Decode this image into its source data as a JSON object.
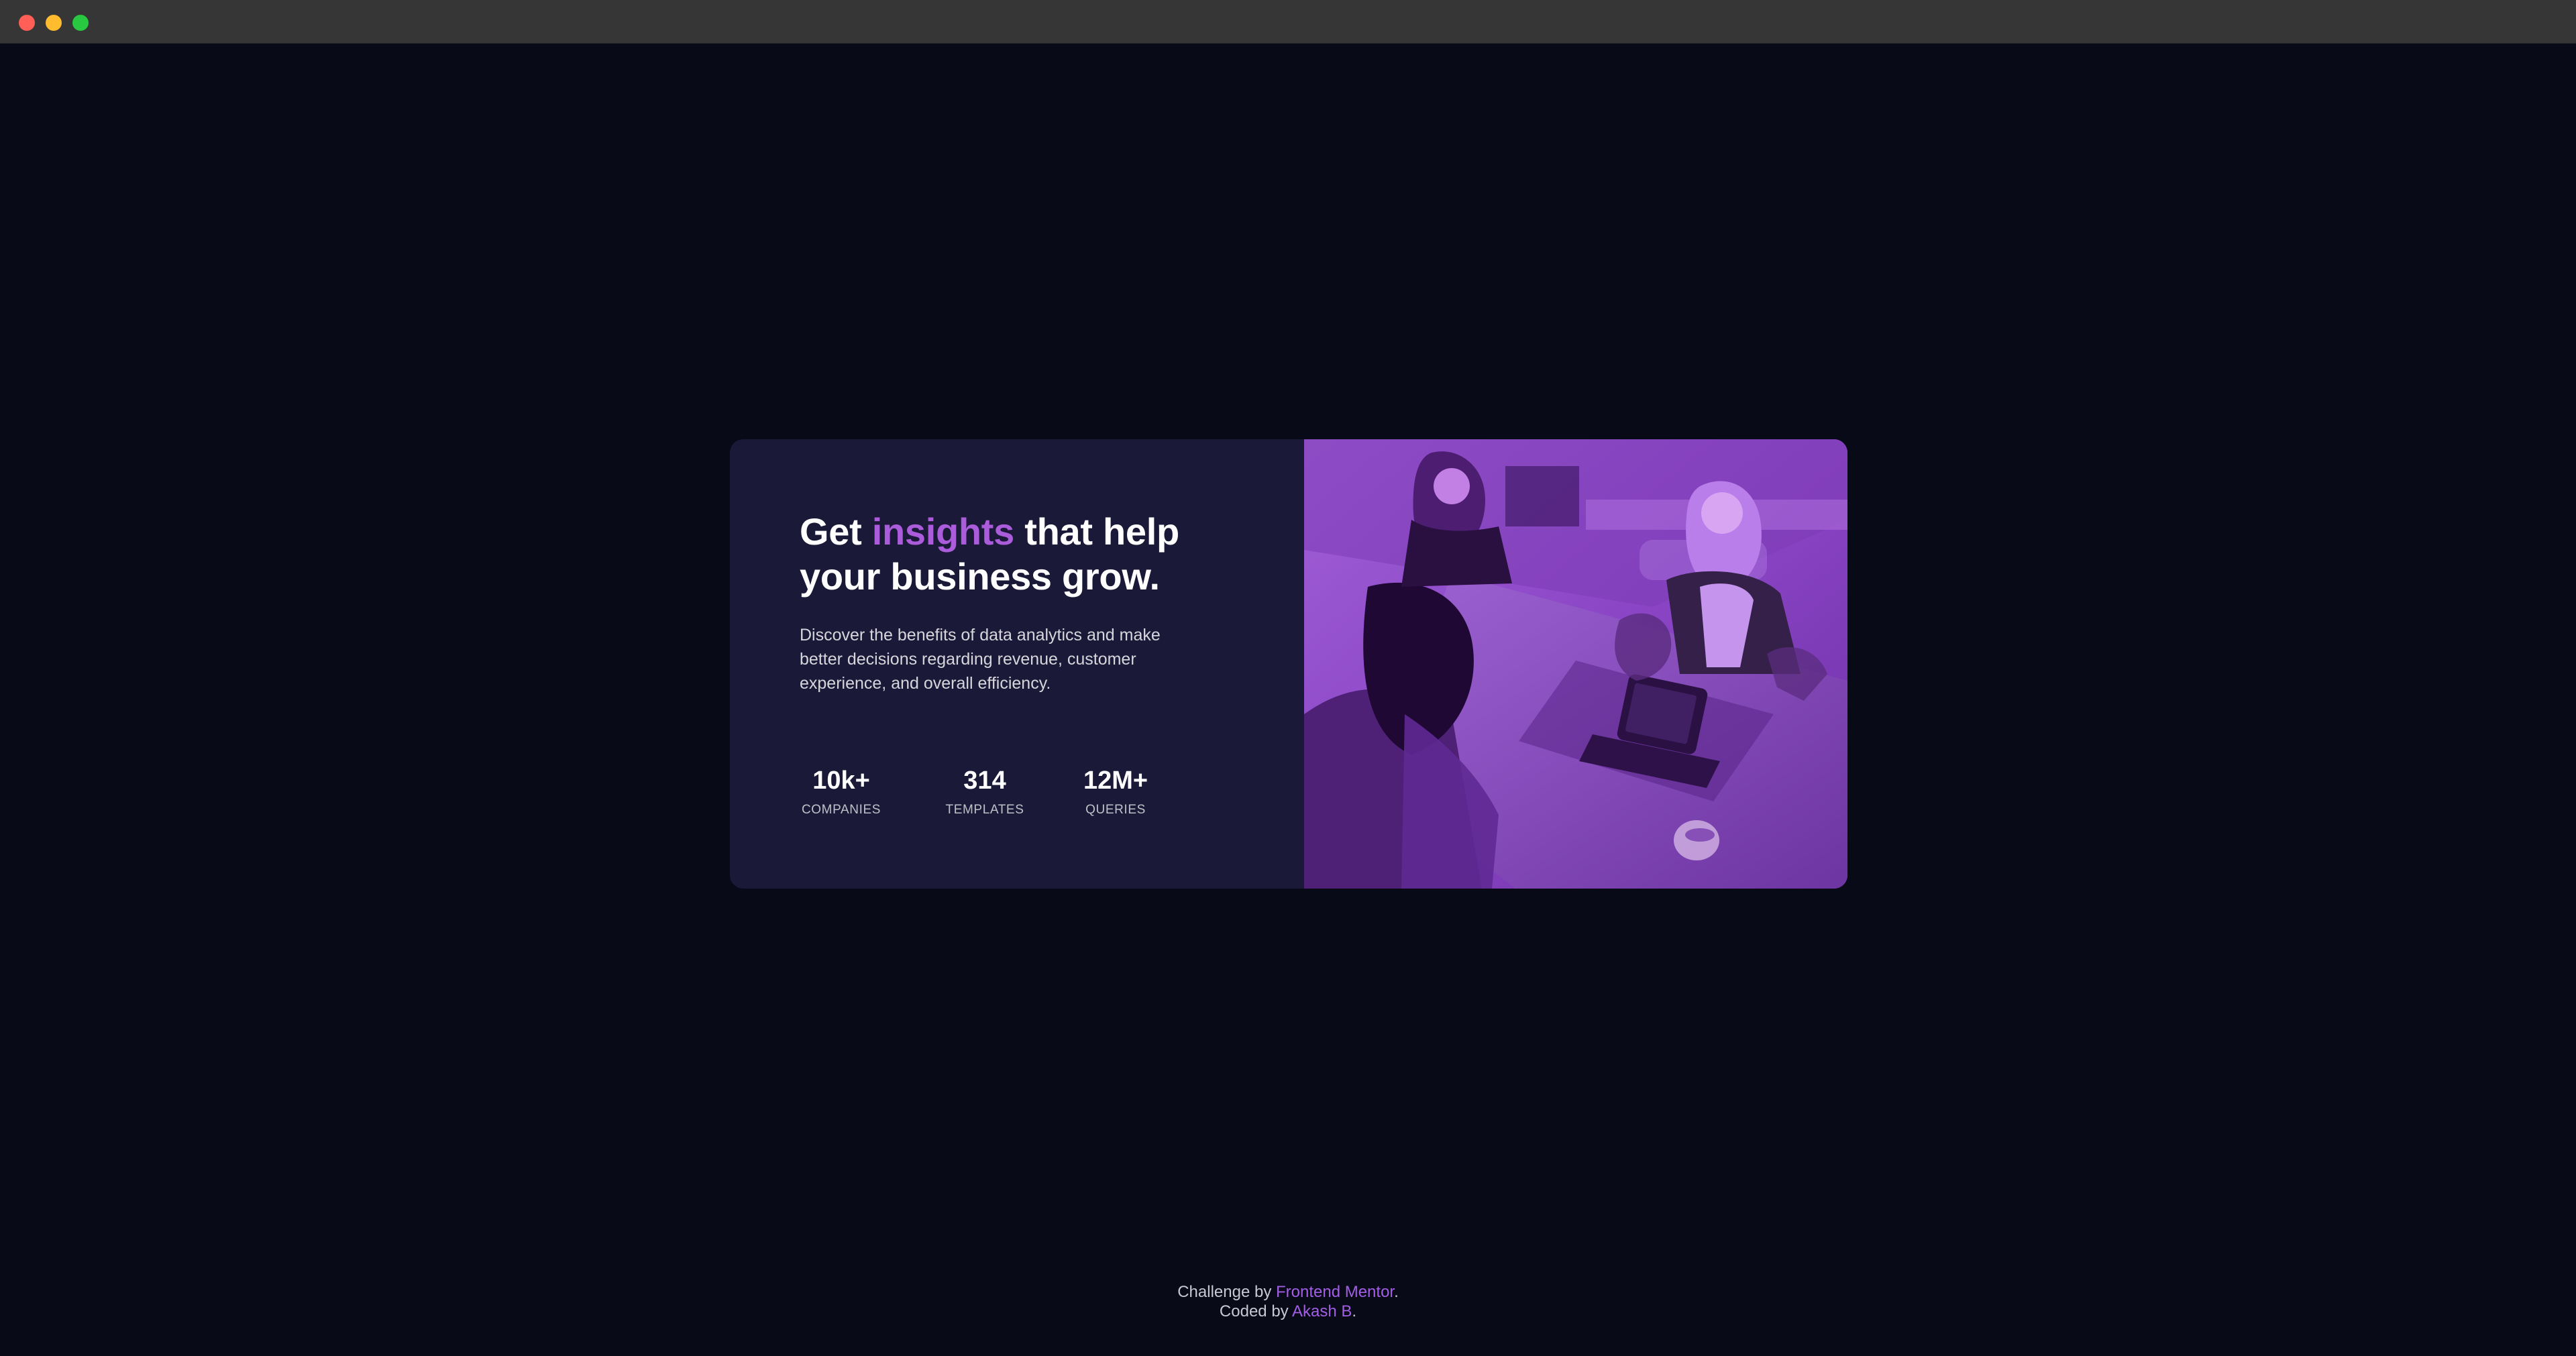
{
  "window": {
    "controls": [
      "close",
      "minimize",
      "maximize"
    ]
  },
  "card": {
    "headline_prefix": "Get ",
    "headline_accent": "insights",
    "headline_suffix": " that help your business grow.",
    "description": "Discover the benefits of data analytics and make better decisions regarding revenue, customer experience, and overall efficiency.",
    "stats": [
      {
        "value": "10k+",
        "label": "COMPANIES"
      },
      {
        "value": "314",
        "label": "TEMPLATES"
      },
      {
        "value": "12M+",
        "label": "QUERIES"
      }
    ],
    "image_icon": "office-meeting-photo"
  },
  "footer": {
    "challenge_prefix": "Challenge by ",
    "challenge_link": "Frontend Mentor",
    "challenge_suffix": ".",
    "coded_prefix": "Coded by ",
    "coded_link": "Akash B",
    "coded_suffix": "."
  },
  "colors": {
    "page_background": "#080b17",
    "card_background": "#1b1938",
    "accent": "#aa5cdb",
    "image_overlay": "#8d4bc8"
  }
}
